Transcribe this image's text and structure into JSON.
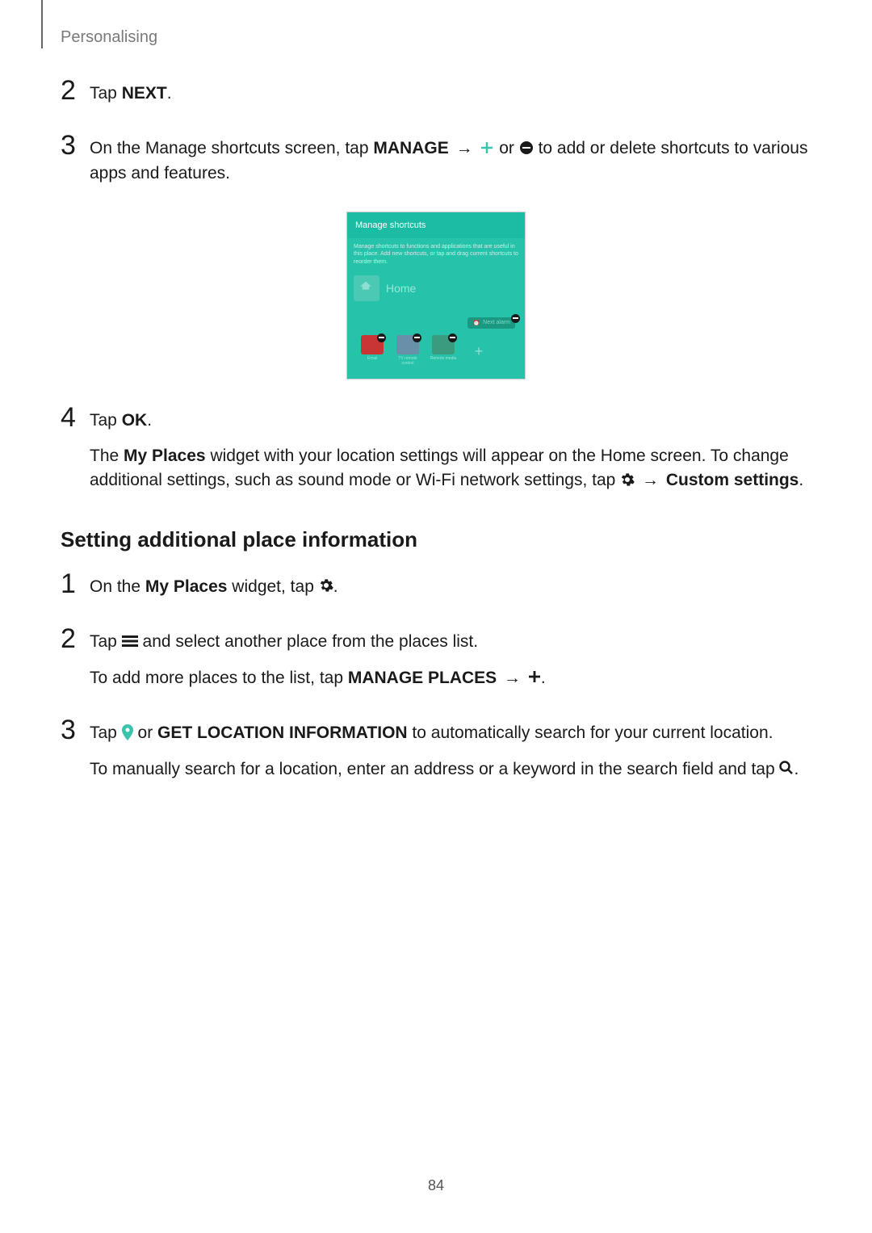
{
  "header": {
    "section": "Personalising"
  },
  "steps_a": [
    {
      "num": "2",
      "parts": [
        "Tap ",
        {
          "b": "NEXT"
        },
        "."
      ]
    },
    {
      "num": "3",
      "parts": [
        "On the Manage shortcuts screen, tap ",
        {
          "b": "MANAGE"
        },
        " ",
        {
          "arrow": "→"
        },
        " ",
        {
          "icon": "plus-cyan"
        },
        " or ",
        {
          "icon": "minus-circle"
        },
        " to add or delete shortcuts to various apps and features."
      ]
    }
  ],
  "screenshot": {
    "title": "Manage shortcuts",
    "desc": "Manage shortcuts to functions and applications that are useful in this place. Add new shortcuts, or tap and drag current shortcuts to reorder them.",
    "home_label": "Home",
    "clock_label": "Next alarm",
    "tiles": [
      "Email",
      "TV remote control",
      "Remote media"
    ]
  },
  "steps_b": [
    {
      "num": "4",
      "paragraphs": [
        {
          "parts": [
            "Tap ",
            {
              "b": "OK"
            },
            "."
          ]
        },
        {
          "parts": [
            "The ",
            {
              "b": "My Places"
            },
            " widget with your location settings will appear on the Home screen. To change additional settings, such as sound mode or Wi-Fi network settings, tap ",
            {
              "icon": "gear"
            },
            " ",
            {
              "arrow": "→"
            },
            " ",
            {
              "b": "Custom settings"
            },
            "."
          ]
        }
      ]
    }
  ],
  "heading": "Setting additional place information",
  "steps_c": [
    {
      "num": "1",
      "paragraphs": [
        {
          "parts": [
            "On the ",
            {
              "b": "My Places"
            },
            " widget, tap ",
            {
              "icon": "gear"
            },
            "."
          ]
        }
      ]
    },
    {
      "num": "2",
      "paragraphs": [
        {
          "parts": [
            "Tap ",
            {
              "icon": "menu"
            },
            " and select another place from the places list."
          ]
        },
        {
          "parts": [
            "To add more places to the list, tap ",
            {
              "b": "MANAGE PLACES"
            },
            " ",
            {
              "arrow": "→"
            },
            " ",
            {
              "icon": "plus-black"
            },
            "."
          ]
        }
      ]
    },
    {
      "num": "3",
      "paragraphs": [
        {
          "parts": [
            "Tap ",
            {
              "icon": "pin"
            },
            " or ",
            {
              "b": "GET LOCATION INFORMATION"
            },
            " to automatically search for your current location."
          ]
        },
        {
          "parts": [
            "To manually search for a location, enter an address or a keyword in the search field and tap ",
            {
              "icon": "search"
            },
            "."
          ]
        }
      ]
    }
  ],
  "page_number": "84"
}
